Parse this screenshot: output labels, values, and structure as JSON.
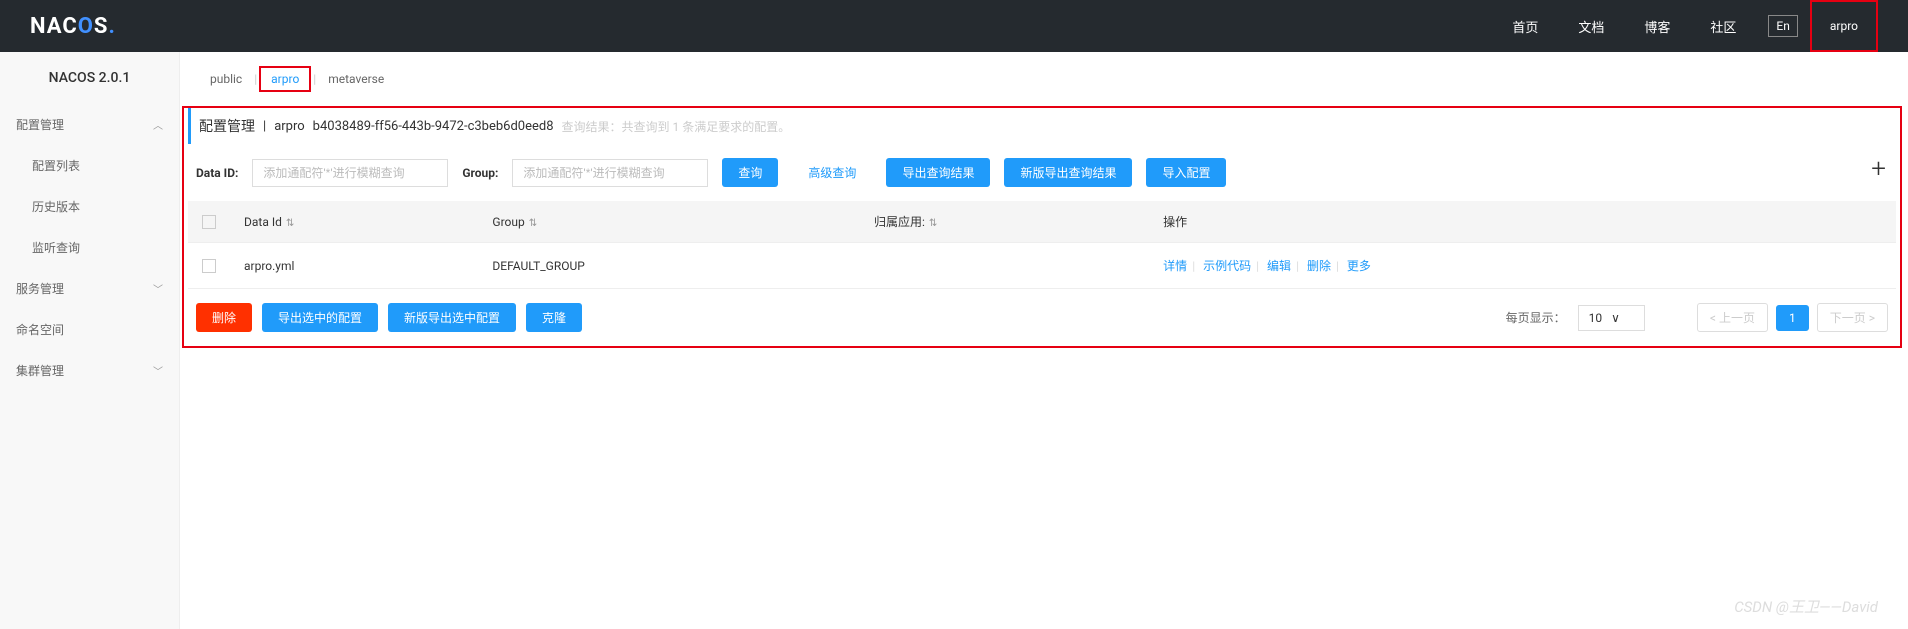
{
  "header": {
    "logo_text": "NACOS.",
    "nav": [
      "首页",
      "文档",
      "博客",
      "社区"
    ],
    "lang": "En",
    "user": "arpro"
  },
  "sidebar": {
    "title": "NACOS 2.0.1",
    "groups": [
      {
        "label": "配置管理",
        "expanded": true,
        "items": [
          "配置列表",
          "历史版本",
          "监听查询"
        ]
      },
      {
        "label": "服务管理",
        "expanded": false,
        "items": []
      },
      {
        "label": "命名空间",
        "expanded": false,
        "items": []
      },
      {
        "label": "集群管理",
        "expanded": false,
        "items": []
      }
    ]
  },
  "tabs": {
    "items": [
      "public",
      "arpro",
      "metaverse"
    ],
    "active_index": 1
  },
  "breadcrumb": {
    "title": "配置管理",
    "sep": "|",
    "namespace": "arpro",
    "ns_id": "b4038489-ff56-443b-9472-c3beb6d0eed8",
    "hint": "查询结果：共查询到 1 条满足要求的配置。"
  },
  "search": {
    "data_id_label": "Data ID:",
    "data_id_placeholder": "添加通配符'*'进行模糊查询",
    "group_label": "Group:",
    "group_placeholder": "添加通配符'*'进行模糊查询",
    "query_btn": "查询",
    "adv_query": "高级查询",
    "export_btn": "导出查询结果",
    "new_export_btn": "新版导出查询结果",
    "import_btn": "导入配置",
    "add_icon": "+"
  },
  "table": {
    "headers": [
      "",
      "Data Id",
      "Group",
      "归属应用:",
      "操作"
    ],
    "rows": [
      {
        "data_id": "arpro.yml",
        "group": "DEFAULT_GROUP",
        "app": ""
      }
    ],
    "actions": {
      "detail": "详情",
      "sample": "示例代码",
      "edit": "编辑",
      "delete": "删除",
      "more": "更多"
    }
  },
  "footer": {
    "delete_btn": "删除",
    "export_sel_btn": "导出选中的配置",
    "new_export_sel_btn": "新版导出选中配置",
    "clone_btn": "克隆",
    "page_size_label": "每页显示：",
    "page_size": "10",
    "prev": "上一页",
    "page": "1",
    "next": "下一页"
  },
  "watermark": "CSDN @王卫——David"
}
